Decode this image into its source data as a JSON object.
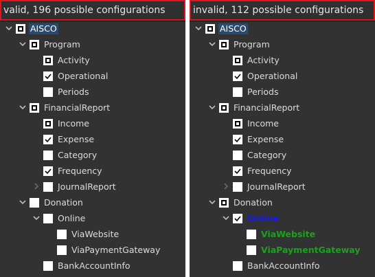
{
  "colors": {
    "header_border": "#e0151f",
    "highlight_blue": "#1a1af0",
    "highlight_green": "#1aa31a",
    "selected_bg": "#2b4a6b"
  },
  "panels": [
    {
      "header": "valid, 196 possible configurations",
      "nodes": [
        {
          "label": "AISCO",
          "level": 0,
          "chevron": "down",
          "check": "indeterminate",
          "style": "selected"
        },
        {
          "label": "Program",
          "level": 1,
          "chevron": "down",
          "check": "indeterminate",
          "style": "normal"
        },
        {
          "label": "Activity",
          "level": 2,
          "chevron": "none",
          "check": "indeterminate",
          "style": "normal"
        },
        {
          "label": "Operational",
          "level": 2,
          "chevron": "none",
          "check": "checked",
          "style": "normal"
        },
        {
          "label": "Periods",
          "level": 2,
          "chevron": "none",
          "check": "unchecked",
          "style": "normal"
        },
        {
          "label": "FinancialReport",
          "level": 1,
          "chevron": "down",
          "check": "indeterminate",
          "style": "normal"
        },
        {
          "label": "Income",
          "level": 2,
          "chevron": "none",
          "check": "indeterminate",
          "style": "normal"
        },
        {
          "label": "Expense",
          "level": 2,
          "chevron": "none",
          "check": "checked",
          "style": "normal"
        },
        {
          "label": "Category",
          "level": 2,
          "chevron": "none",
          "check": "unchecked",
          "style": "normal"
        },
        {
          "label": "Frequency",
          "level": 2,
          "chevron": "none",
          "check": "checked",
          "style": "normal"
        },
        {
          "label": "JournalReport",
          "level": 2,
          "chevron": "right",
          "check": "unchecked",
          "style": "normal"
        },
        {
          "label": "Donation",
          "level": 1,
          "chevron": "down",
          "check": "unchecked",
          "style": "normal"
        },
        {
          "label": "Online",
          "level": 2,
          "chevron": "down",
          "check": "unchecked",
          "style": "normal"
        },
        {
          "label": "ViaWebsite",
          "level": 3,
          "chevron": "none",
          "check": "unchecked",
          "style": "normal"
        },
        {
          "label": "ViaPaymentGateway",
          "level": 3,
          "chevron": "none",
          "check": "unchecked",
          "style": "normal"
        },
        {
          "label": "BankAccountInfo",
          "level": 2,
          "chevron": "none",
          "check": "unchecked",
          "style": "normal"
        }
      ]
    },
    {
      "header": "invalid, 112 possible configurations",
      "nodes": [
        {
          "label": "AISCO",
          "level": 0,
          "chevron": "down",
          "check": "indeterminate",
          "style": "selected"
        },
        {
          "label": "Program",
          "level": 1,
          "chevron": "down",
          "check": "indeterminate",
          "style": "normal"
        },
        {
          "label": "Activity",
          "level": 2,
          "chevron": "none",
          "check": "indeterminate",
          "style": "normal"
        },
        {
          "label": "Operational",
          "level": 2,
          "chevron": "none",
          "check": "checked",
          "style": "normal"
        },
        {
          "label": "Periods",
          "level": 2,
          "chevron": "none",
          "check": "unchecked",
          "style": "normal"
        },
        {
          "label": "FinancialReport",
          "level": 1,
          "chevron": "down",
          "check": "indeterminate",
          "style": "normal"
        },
        {
          "label": "Income",
          "level": 2,
          "chevron": "none",
          "check": "indeterminate",
          "style": "normal"
        },
        {
          "label": "Expense",
          "level": 2,
          "chevron": "none",
          "check": "checked",
          "style": "normal"
        },
        {
          "label": "Category",
          "level": 2,
          "chevron": "none",
          "check": "unchecked",
          "style": "normal"
        },
        {
          "label": "Frequency",
          "level": 2,
          "chevron": "none",
          "check": "checked",
          "style": "normal"
        },
        {
          "label": "JournalReport",
          "level": 2,
          "chevron": "right",
          "check": "unchecked",
          "style": "normal"
        },
        {
          "label": "Donation",
          "level": 1,
          "chevron": "down",
          "check": "indeterminate",
          "style": "normal"
        },
        {
          "label": "Online",
          "level": 2,
          "chevron": "down",
          "check": "checked",
          "style": "blue"
        },
        {
          "label": "ViaWebsite",
          "level": 3,
          "chevron": "none",
          "check": "unchecked",
          "style": "green"
        },
        {
          "label": "ViaPaymentGateway",
          "level": 3,
          "chevron": "none",
          "check": "unchecked",
          "style": "green"
        },
        {
          "label": "BankAccountInfo",
          "level": 2,
          "chevron": "none",
          "check": "unchecked",
          "style": "normal"
        }
      ]
    }
  ]
}
